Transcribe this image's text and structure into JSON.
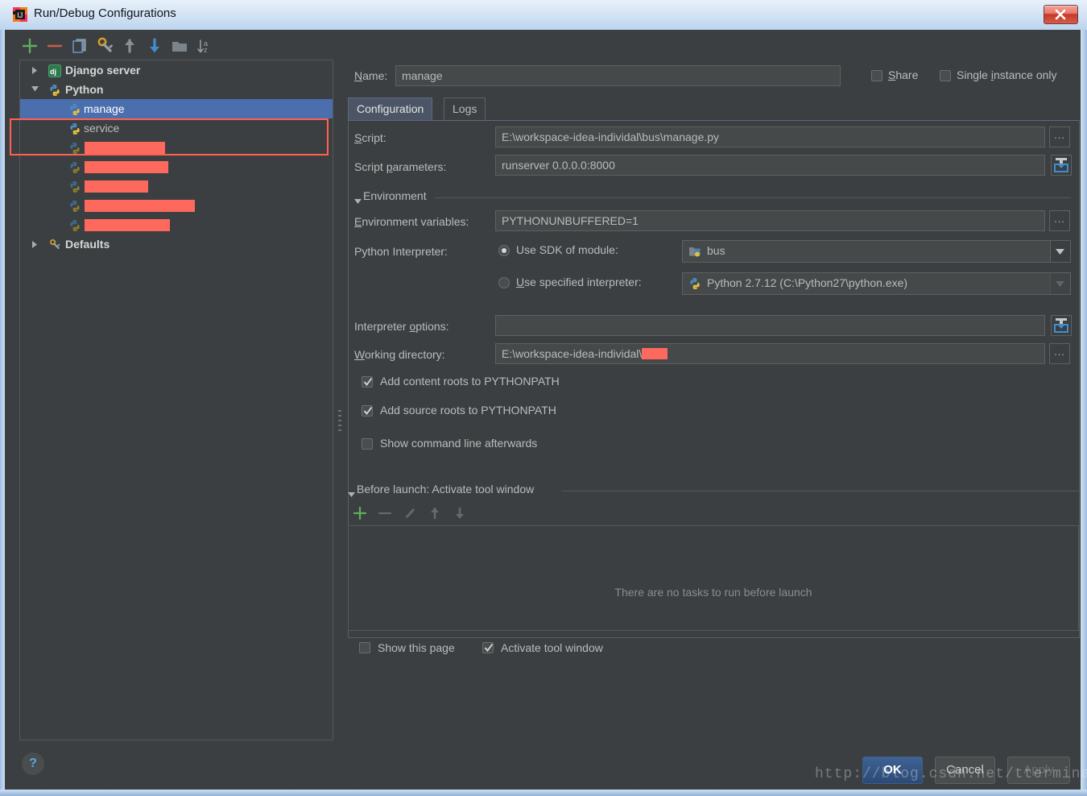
{
  "window": {
    "title": "Run/Debug Configurations",
    "close_label": "Close",
    "app_icon": "intellij-icon"
  },
  "tree_toolbar": {
    "items": [
      {
        "name": "add-configuration-button",
        "icon": "plus-icon",
        "tooltip": "Add New Configuration"
      },
      {
        "name": "remove-configuration-button",
        "icon": "minus-icon",
        "tooltip": "Remove Configuration"
      },
      {
        "name": "copy-configuration-button",
        "icon": "copy-icon",
        "tooltip": "Copy Configuration"
      },
      {
        "name": "edit-defaults-button",
        "icon": "wrench-icon",
        "tooltip": "Edit defaults"
      },
      {
        "name": "move-up-button",
        "icon": "arrow-up-icon",
        "tooltip": "Move Up"
      },
      {
        "name": "move-down-button",
        "icon": "arrow-down-icon",
        "tooltip": "Move Down"
      },
      {
        "name": "create-folder-button",
        "icon": "folder-icon",
        "tooltip": "Create New Folder"
      },
      {
        "name": "sort-configurations-button",
        "icon": "sort-az-icon",
        "tooltip": "Sort Configurations"
      }
    ]
  },
  "tree": {
    "nodes": [
      {
        "label": "Django server",
        "icon": "django-icon",
        "level": 0,
        "twisty": "collapsed",
        "selected": false,
        "redacted": false
      },
      {
        "label": "Python",
        "icon": "python-icon",
        "level": 0,
        "twisty": "expanded",
        "selected": false,
        "redacted": false
      },
      {
        "label": "manage",
        "icon": "python-icon",
        "level": 1,
        "twisty": "none",
        "selected": true,
        "redacted": false
      },
      {
        "label": "service",
        "icon": "python-icon",
        "level": 1,
        "twisty": "none",
        "selected": false,
        "redacted": false
      },
      {
        "label": "",
        "icon": "python-icon",
        "level": 1,
        "twisty": "none",
        "selected": false,
        "redacted": true,
        "redact_width": 100
      },
      {
        "label": "",
        "icon": "python-icon",
        "level": 1,
        "twisty": "none",
        "selected": false,
        "redacted": true,
        "redact_width": 104
      },
      {
        "label": "",
        "icon": "python-icon",
        "level": 1,
        "twisty": "none",
        "selected": false,
        "redacted": true,
        "redact_width": 79
      },
      {
        "label": "",
        "icon": "python-icon",
        "level": 1,
        "twisty": "none",
        "selected": false,
        "redacted": true,
        "redact_width": 137
      },
      {
        "label": "",
        "icon": "python-icon",
        "level": 1,
        "twisty": "none",
        "selected": false,
        "redacted": true,
        "redact_width": 106
      },
      {
        "label": "Defaults",
        "icon": "wrench-icon",
        "level": 0,
        "twisty": "collapsed",
        "selected": false,
        "redacted": false
      }
    ]
  },
  "header": {
    "name_label": "Name:",
    "name_value": "manage",
    "share_label": "Share",
    "share_checked": false,
    "single_instance_label": "Single instance only",
    "single_instance_checked": false
  },
  "tabs": [
    {
      "label": "Configuration",
      "active": true
    },
    {
      "label": "Logs",
      "active": false
    }
  ],
  "configuration": {
    "script_label": "Script:",
    "script_value": "E:\\workspace-idea-individal\\bus\\manage.py",
    "script_params_label": "Script parameters:",
    "script_params_value": "runserver 0.0.0.0:8000",
    "environment_section": "Environment",
    "env_vars_label": "Environment variables:",
    "env_vars_value": "PYTHONUNBUFFERED=1",
    "interpreter_label": "Python Interpreter:",
    "use_sdk_label": "Use SDK of module:",
    "use_sdk_selected": true,
    "sdk_module_value": "bus",
    "use_specified_label": "Use specified interpreter:",
    "use_specified_selected": false,
    "specified_interpreter_value": "Python 2.7.12 (C:\\Python27\\python.exe)",
    "interp_options_label": "Interpreter options:",
    "interp_options_value": "",
    "working_dir_label": "Working directory:",
    "working_dir_value": "E:\\workspace-idea-individal\\",
    "working_dir_redacted": true,
    "add_content_roots_label": "Add content roots to PYTHONPATH",
    "add_content_roots_checked": true,
    "add_source_roots_label": "Add source roots to PYTHONPATH",
    "add_source_roots_checked": true,
    "show_cmdline_label": "Show command line afterwards",
    "show_cmdline_checked": false
  },
  "before_launch": {
    "section_label": "Before launch: Activate tool window",
    "toolbar": [
      {
        "name": "add-task-button",
        "icon": "plus-icon",
        "enabled": true
      },
      {
        "name": "remove-task-button",
        "icon": "minus-icon",
        "enabled": false
      },
      {
        "name": "edit-task-button",
        "icon": "pencil-icon",
        "enabled": false
      },
      {
        "name": "task-up-button",
        "icon": "arrow-up-icon",
        "enabled": false
      },
      {
        "name": "task-down-button",
        "icon": "arrow-down-icon",
        "enabled": false
      }
    ],
    "empty_text": "There are no tasks to run before launch",
    "show_page_label": "Show this page",
    "show_page_checked": false,
    "activate_tool_window_label": "Activate tool window",
    "activate_tool_window_checked": true
  },
  "footer": {
    "help_label": "?",
    "ok_label": "OK",
    "cancel_label": "Cancel",
    "apply_label": "Apply",
    "apply_enabled": false
  },
  "watermark": {
    "text": "http://blog.csdn.net/tterminator"
  },
  "colors": {
    "panel_bg": "#3c3f41",
    "field_bg": "#45494a",
    "selection": "#4b6eaf",
    "accent_red": "#ff6151",
    "redaction": "#fd6a5d",
    "titlebar": "#cfe0f2"
  }
}
